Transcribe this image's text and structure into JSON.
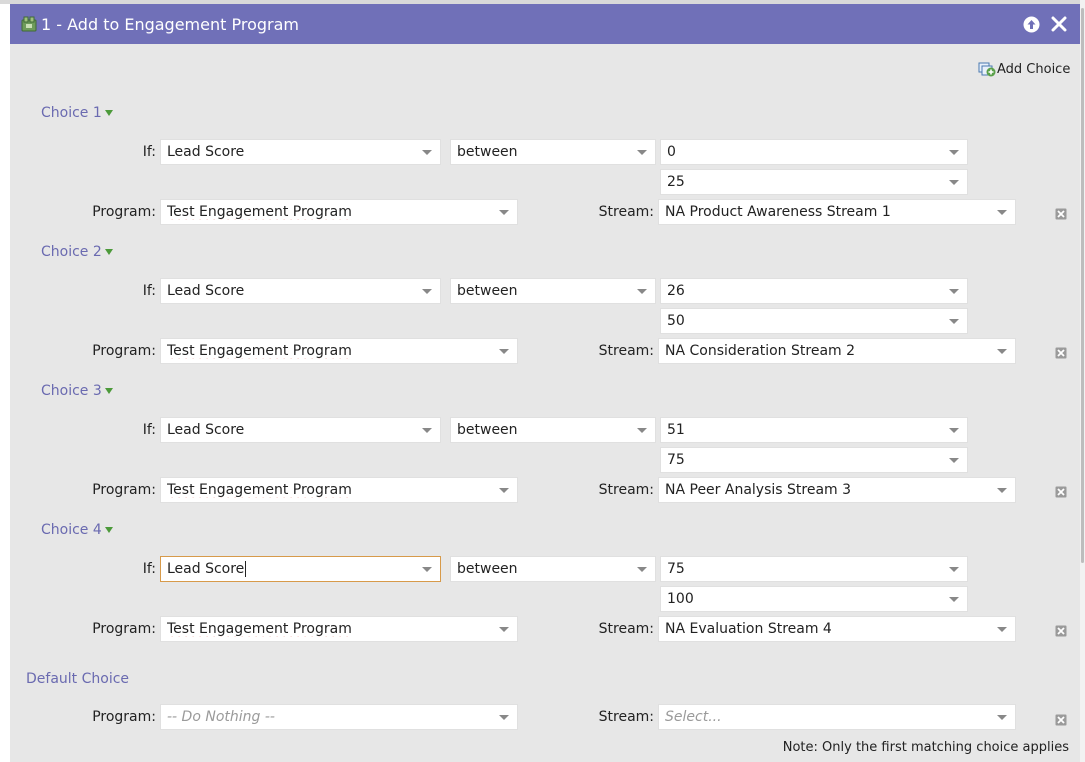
{
  "window": {
    "title": "1 - Add to Engagement Program"
  },
  "toolbar": {
    "add_choice_label": "Add Choice"
  },
  "labels": {
    "if": "If:",
    "program": "Program:",
    "stream": "Stream:"
  },
  "choices": [
    {
      "heading": "Choice 1",
      "field": "Lead Score",
      "operator": "between",
      "value_from": "0",
      "value_to": "25",
      "program": "Test Engagement Program",
      "stream": "NA Product Awareness Stream 1"
    },
    {
      "heading": "Choice 2",
      "field": "Lead Score",
      "operator": "between",
      "value_from": "26",
      "value_to": "50",
      "program": "Test Engagement Program",
      "stream": "NA Consideration Stream 2"
    },
    {
      "heading": "Choice 3",
      "field": "Lead Score",
      "operator": "between",
      "value_from": "51",
      "value_to": "75",
      "program": "Test Engagement Program",
      "stream": "NA Peer Analysis Stream 3"
    },
    {
      "heading": "Choice 4",
      "field": "Lead Score",
      "operator": "between",
      "value_from": "75",
      "value_to": "100",
      "program": "Test Engagement Program",
      "stream": "NA Evaluation Stream 4"
    }
  ],
  "default_choice": {
    "heading": "Default Choice",
    "program_placeholder": "-- Do Nothing --",
    "stream_placeholder": "Select..."
  },
  "note": "Note: Only the first matching choice applies",
  "colors": {
    "titlebar": "#7070b8",
    "heading": "#6a6ab0",
    "panel": "#e7e7e7",
    "focus_border": "#d79a4a"
  },
  "icons": {
    "title": "flow-step-icon",
    "collapse": "arrow-up-circle-icon",
    "close": "close-x-icon",
    "add_choice": "add-choice-icon",
    "delete": "delete-box-icon",
    "expand": "triangle-down-icon"
  }
}
